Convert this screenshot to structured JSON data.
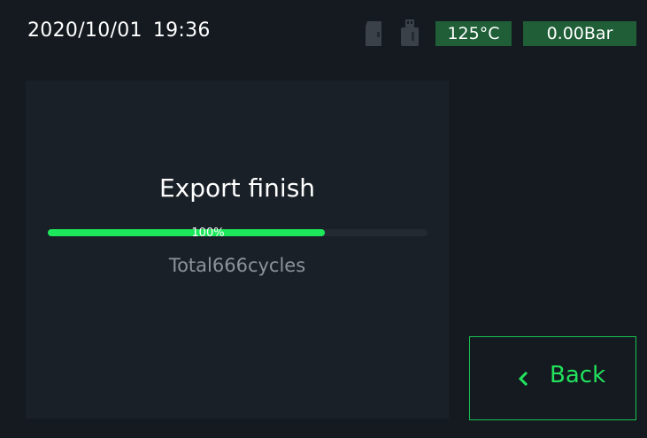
{
  "status_bar": {
    "date": "2020/10/01",
    "time": "19:36",
    "sd_icon": "sd-card-icon",
    "usb_icon": "usb-drive-icon",
    "temperature": "125°C",
    "pressure": "0.00Bar"
  },
  "export": {
    "title": "Export finish",
    "progress_text": "100%",
    "progress_fraction": 0.73,
    "summary": "Total666cycles"
  },
  "back_button": {
    "icon": "chevron-left-icon",
    "label": "Back"
  },
  "colors": {
    "background": "#141a20",
    "panel": "#192027",
    "accent_green": "#1de85b",
    "badge_green": "#1f5e37",
    "muted_text": "#8c949a"
  }
}
